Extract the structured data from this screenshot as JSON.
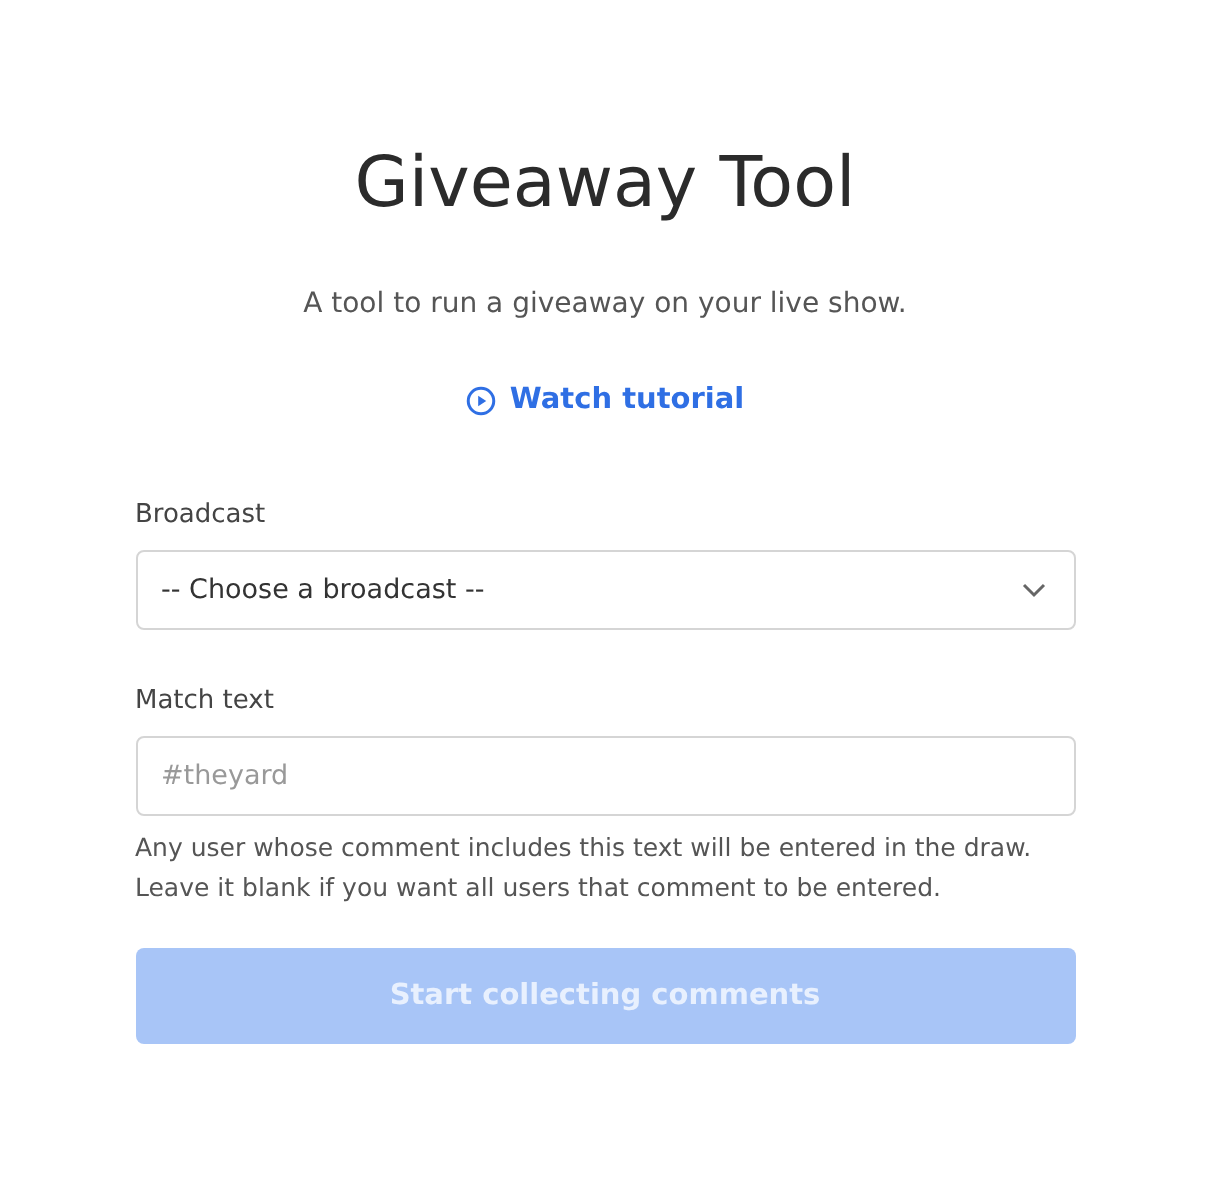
{
  "title": "Giveaway Tool",
  "subtitle": "A tool to run a giveaway on your live show.",
  "tutorial_link": {
    "label": "Watch tutorial"
  },
  "broadcast": {
    "label": "Broadcast",
    "value": "-- Choose a broadcast --"
  },
  "match_text": {
    "label": "Match text",
    "placeholder": "#theyard",
    "help": "Any user whose comment includes this text will be entered in the draw. Leave it blank if you want all users that comment to be entered."
  },
  "submit": {
    "label": "Start collecting comments",
    "disabled": true
  }
}
